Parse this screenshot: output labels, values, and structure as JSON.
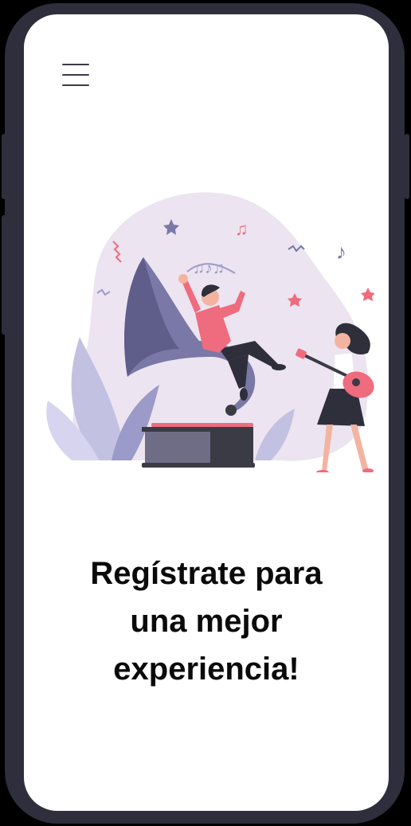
{
  "header": {
    "menu_icon": "hamburger-menu-icon"
  },
  "hero": {
    "illustration": "music-party-illustration",
    "headline_lines": [
      "Regístrate para",
      "una mejor",
      "experiencia!"
    ]
  },
  "colors": {
    "frame": "#2e2e3c",
    "screen": "#ffffff",
    "text": "#0a0a0a",
    "accent_pink": "#ef6b7e",
    "accent_purple": "#8583ad",
    "blob": "#ece4f0"
  }
}
